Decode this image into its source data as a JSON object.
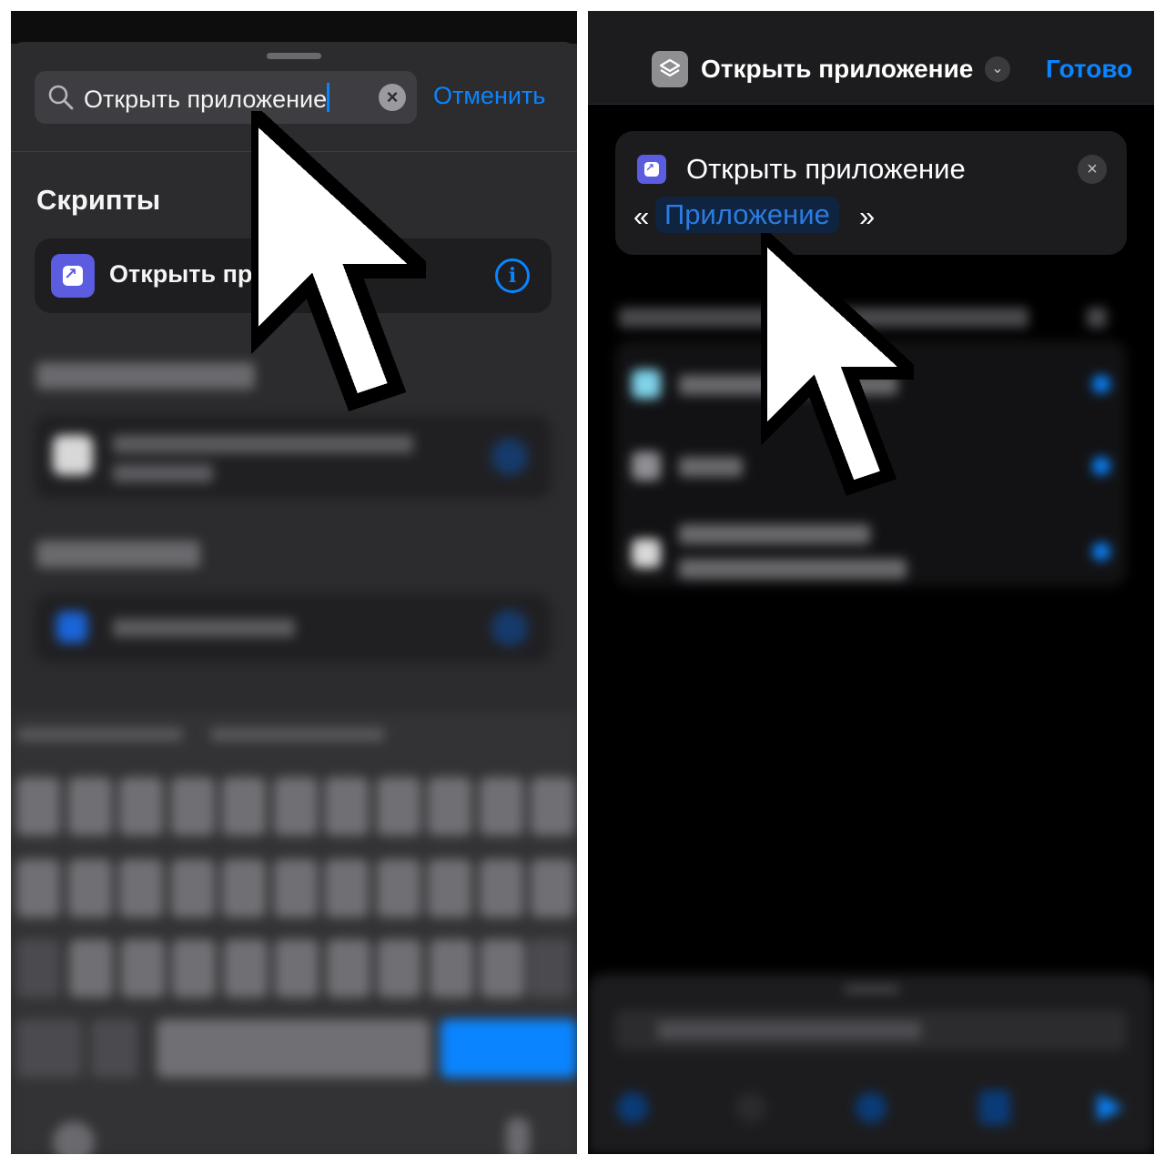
{
  "left_panel": {
    "search": {
      "query": "Открыть приложение",
      "clear_icon": "clear-x-icon"
    },
    "cancel_label": "Отменить",
    "section_scripts": "Скрипты",
    "result_item": {
      "label": "Открыть пр",
      "icon": "open-app-icon",
      "info_icon": "info-icon"
    }
  },
  "right_panel": {
    "header": {
      "title": "Открыть приложение",
      "done_label": "Готово"
    },
    "action_card": {
      "title": "Открыть приложение",
      "quote_open": "«",
      "parameter": "Приложение",
      "quote_close": "»"
    }
  },
  "colors": {
    "accent": "#0a84ff",
    "app_icon": "#5b5ce0",
    "panel_dark": "#2c2c2f",
    "background_black": "#000000"
  },
  "overlay": {
    "cursor_icon": "pointer-cursor-icon"
  }
}
